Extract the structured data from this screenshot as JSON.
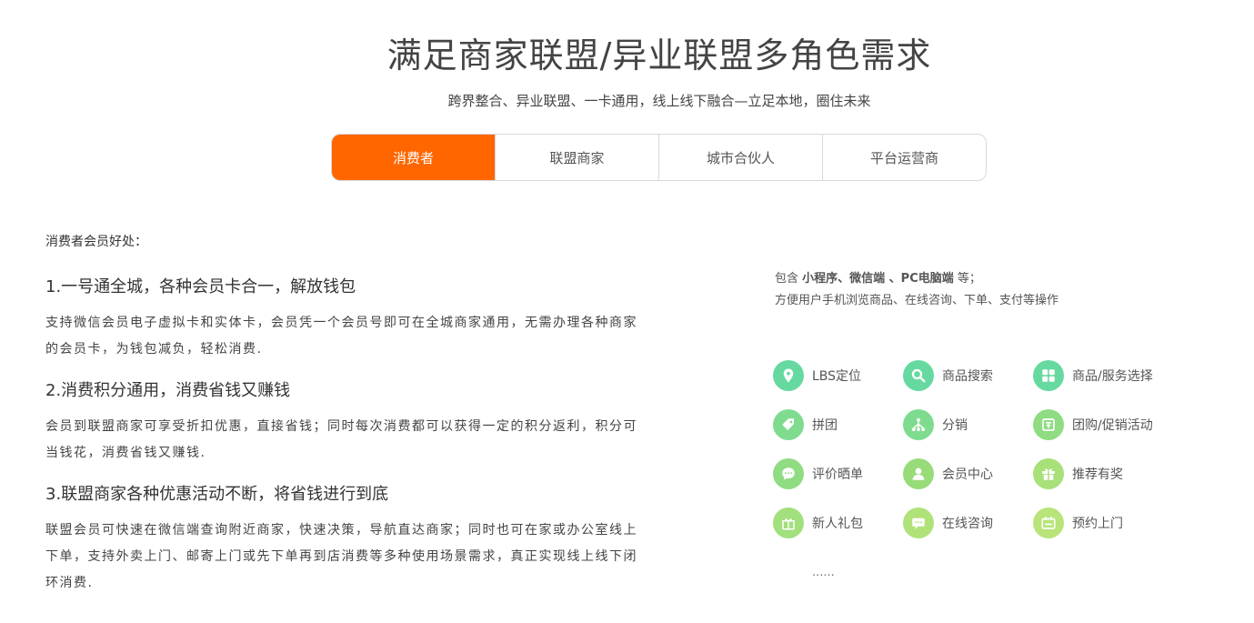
{
  "header": {
    "title": "满足商家联盟/异业联盟多角色需求",
    "subtitle": "跨界整合、异业联盟、一卡通用，线上线下融合—立足本地，圈住未来"
  },
  "tabs": [
    {
      "label": "消费者",
      "active": true
    },
    {
      "label": "联盟商家",
      "active": false
    },
    {
      "label": "城市合伙人",
      "active": false
    },
    {
      "label": "平台运营商",
      "active": false
    }
  ],
  "content": {
    "intro": "消费者会员好处：",
    "points": [
      {
        "title": "1.一号通全城，各种会员卡合一，解放钱包",
        "desc": "支持微信会员电子虚拟卡和实体卡，会员凭一个会员号即可在全城商家通用，无需办理各种商家的会员卡，为钱包减负，轻松消费."
      },
      {
        "title": "2.消费积分通用，消费省钱又赚钱",
        "desc": "会员到联盟商家可享受折扣优惠，直接省钱；同时每次消费都可以获得一定的积分返利，积分可当钱花，消费省钱又赚钱."
      },
      {
        "title": "3.联盟商家各种优惠活动不断，将省钱进行到底",
        "desc": "联盟会员可快速在微信端查询附近商家，快速决策，导航直达商家；同时也可在家或办公室线上下单，支持外卖上门、邮寄上门或先下单再到店消费等多种使用场景需求，真正实现线上线下闭环消费."
      }
    ]
  },
  "platforms": {
    "prefix": "包含",
    "bold": "小程序、微信端 、PC电脑端",
    "suffix": "等；",
    "line2": "方便用户手机浏览商品、在线咨询、下单、支付等操作"
  },
  "features": [
    {
      "label": "LBS定位",
      "icon": "location-pin-icon",
      "color": "#66d9a0"
    },
    {
      "label": "商品搜索",
      "icon": "search-icon",
      "color": "#66d9a0"
    },
    {
      "label": "商品/服务选择",
      "icon": "grid-icon",
      "color": "#66d9a0"
    },
    {
      "label": "拼团",
      "icon": "tag-icon",
      "color": "#7fdc8f"
    },
    {
      "label": "分销",
      "icon": "share-tree-icon",
      "color": "#7fdc8f"
    },
    {
      "label": "团购/促销活动",
      "icon": "group-buy-icon",
      "color": "#8fdc82"
    },
    {
      "label": "评价晒单",
      "icon": "chat-bubble-icon",
      "color": "#8fdc82"
    },
    {
      "label": "会员中心",
      "icon": "user-icon",
      "color": "#98dc7a"
    },
    {
      "label": "推荐有奖",
      "icon": "gift-icon",
      "color": "#a8e07a"
    },
    {
      "label": "新人礼包",
      "icon": "gift-box-icon",
      "color": "#a2df7d"
    },
    {
      "label": "在线咨询",
      "icon": "message-icon",
      "color": "#b0e27a"
    },
    {
      "label": "预约上门",
      "icon": "calendar-icon",
      "color": "#b8e47a"
    }
  ],
  "more": "......"
}
